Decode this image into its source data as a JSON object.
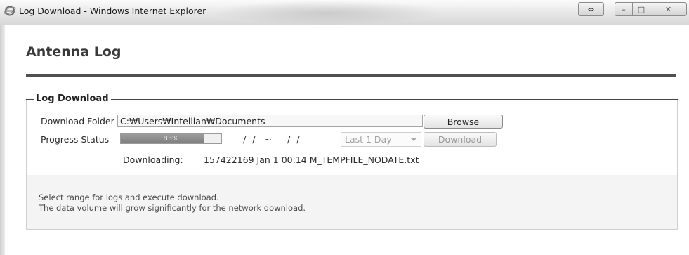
{
  "window": {
    "title": "Log Download - Windows Internet Explorer",
    "restore_frame_glyph": "⇔",
    "minimize_glyph": "–",
    "maximize_glyph": "□",
    "close_glyph": "✕"
  },
  "page": {
    "title": "Antenna Log"
  },
  "log_download": {
    "group_title": "Log Download",
    "folder_label": "Download Folder",
    "folder_value": "C:₩Users₩Intellian₩Documents",
    "browse_label": "Browse",
    "progress_label": "Progress  Status",
    "progress_percent_text": "83%",
    "progress_value": 0.83,
    "date_range": "----/--/-- ~ ----/--/--",
    "range_selected": "Last 1 Day",
    "download_label": "Download",
    "downloading_label": "Downloading:",
    "downloading_file": "157422169 Jan  1 00:14 M_TEMPFILE_NODATE.txt"
  },
  "info": {
    "line1": "Select range for logs and execute download.",
    "line2": "The data volume will grow significantly for the network download."
  },
  "icons": {
    "browser": "ie-icon",
    "dropdown": "chevron-down-icon"
  }
}
